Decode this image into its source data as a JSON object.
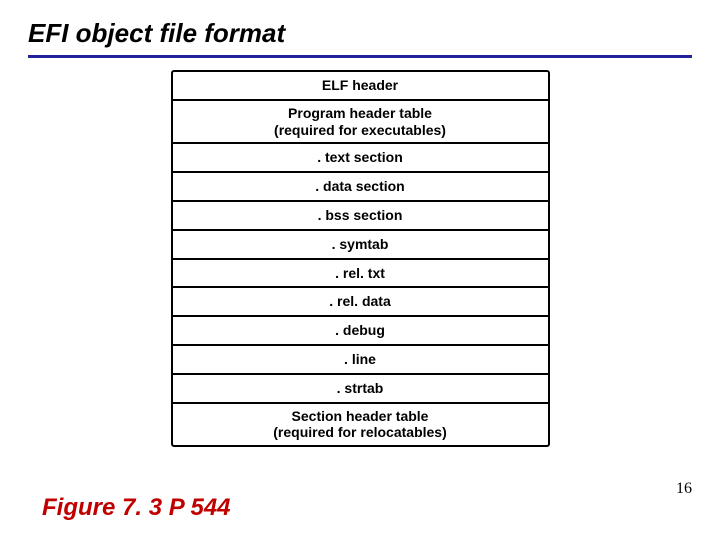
{
  "title": "EFI object file format",
  "rows": [
    {
      "label": "ELF header"
    },
    {
      "label": "Program header table\n(required for executables)",
      "two_line": true
    },
    {
      "label": ". text section"
    },
    {
      "label": ". data section"
    },
    {
      "label": ". bss section"
    },
    {
      "label": ". symtab"
    },
    {
      "label": ". rel. txt"
    },
    {
      "label": ". rel. data"
    },
    {
      "label": ". debug"
    },
    {
      "label": ". line"
    },
    {
      "label": ". strtab"
    },
    {
      "label": "Section header table\n(required for relocatables)",
      "two_line": true
    }
  ],
  "caption": "Figure 7. 3  P 544",
  "page_number": "16"
}
